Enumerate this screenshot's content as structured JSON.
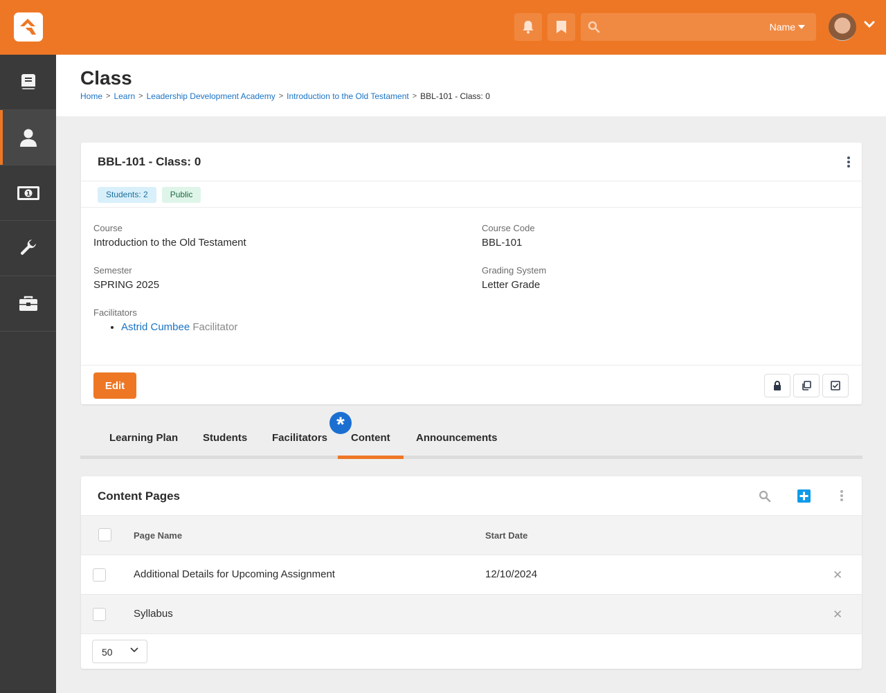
{
  "topbar": {
    "search_filter": "Name",
    "icons": [
      "rock-logo-icon",
      "bell-icon",
      "bookmark-icon",
      "search-icon",
      "caret-down-icon",
      "avatar",
      "chevron-down-icon"
    ],
    "brand_color": "#ee7725"
  },
  "sidebar": {
    "items": [
      {
        "icon": "book-icon",
        "active": false
      },
      {
        "icon": "user-icon",
        "active": true
      },
      {
        "icon": "money-icon",
        "active": false
      },
      {
        "icon": "wrench-icon",
        "active": false
      },
      {
        "icon": "briefcase-icon",
        "active": false
      }
    ]
  },
  "header": {
    "title": "Class",
    "breadcrumb": [
      {
        "label": "Home",
        "link": true
      },
      {
        "label": "Learn",
        "link": true
      },
      {
        "label": "Leadership Development Academy",
        "link": true
      },
      {
        "label": "Introduction to the Old Testament",
        "link": true
      },
      {
        "label": "BBL-101 - Class: 0",
        "link": false
      }
    ]
  },
  "detail": {
    "title": "BBL-101 - Class: 0",
    "badges": [
      {
        "label": "Students: 2",
        "type": "info"
      },
      {
        "label": "Public",
        "type": "success"
      }
    ],
    "fields": {
      "course": {
        "label": "Course",
        "value": "Introduction to the Old Testament"
      },
      "course_code": {
        "label": "Course Code",
        "value": "BBL-101"
      },
      "semester": {
        "label": "Semester",
        "value": "SPRING 2025"
      },
      "grading": {
        "label": "Grading System",
        "value": "Letter Grade"
      },
      "facilitators": {
        "label": "Facilitators",
        "items": [
          {
            "name": "Astrid Cumbee",
            "role": "Facilitator"
          }
        ]
      }
    },
    "edit_label": "Edit",
    "secondary_buttons": [
      "lock-icon",
      "copy-icon",
      "checkbox-icon"
    ]
  },
  "tabs": {
    "items": [
      "Learning Plan",
      "Students",
      "Facilitators",
      "Content",
      "Announcements"
    ],
    "active": "Content",
    "new_badge": "*"
  },
  "grid": {
    "title": "Content Pages",
    "columns": [
      "Page Name",
      "Start Date"
    ],
    "rows": [
      {
        "page_name": "Additional Details for Upcoming Assignment",
        "start_date": "12/10/2024"
      },
      {
        "page_name": "Syllabus",
        "start_date": ""
      }
    ],
    "delete_glyph": "✕",
    "page_size": "50"
  }
}
